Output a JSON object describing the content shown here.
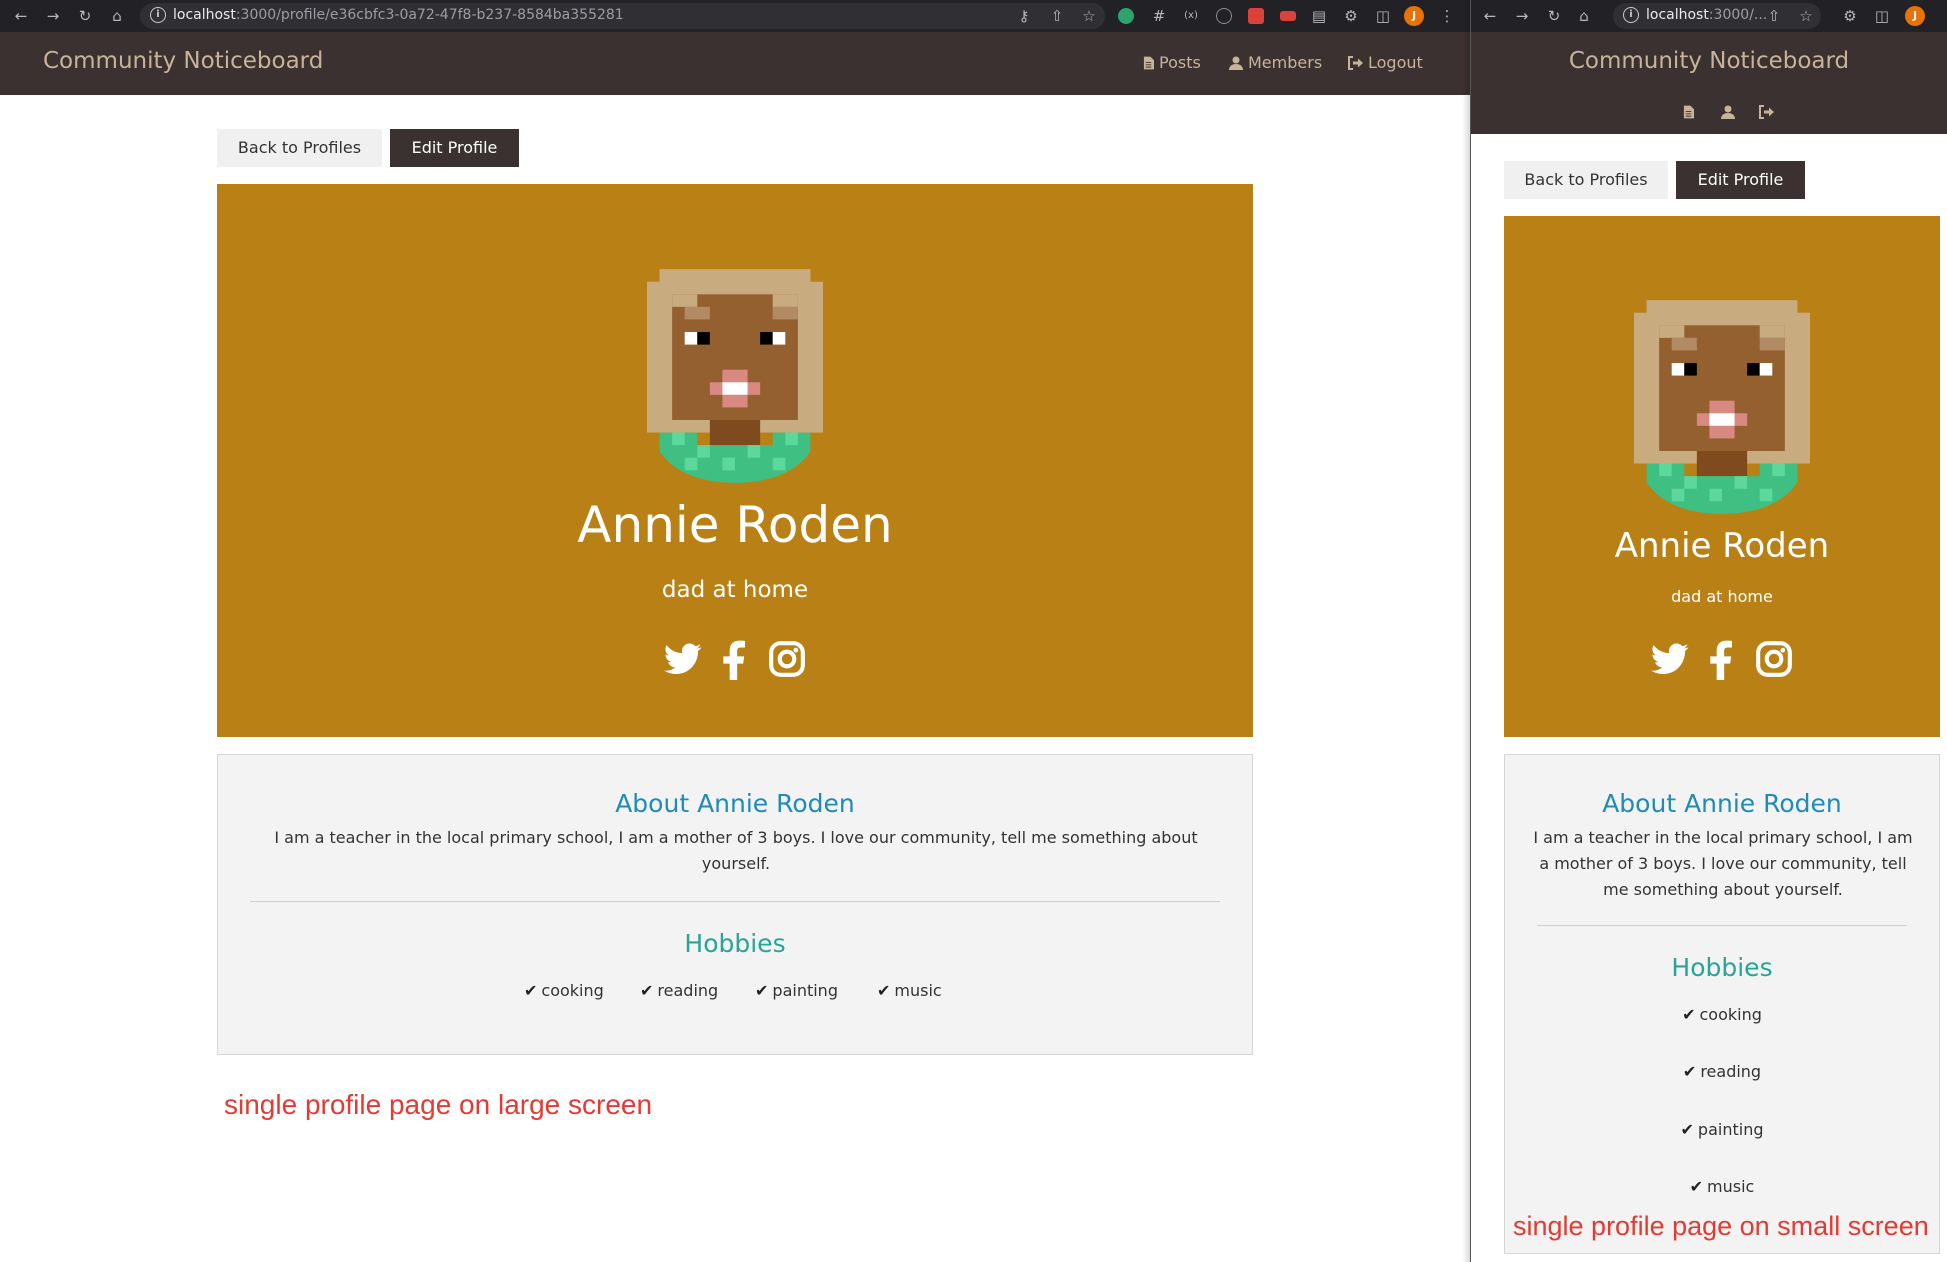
{
  "large": {
    "url_host": "localhost",
    "url_path": ":3000/profile/e36cbfc3-0a72-47f8-b237-8584ba355281",
    "brand": "Community Noticeboard",
    "nav": {
      "posts": "Posts",
      "members": "Members",
      "logout": "Logout"
    },
    "back_label": "Back to Profiles",
    "edit_label": "Edit Profile",
    "profile": {
      "name": "Annie Roden",
      "tagline": "dad at home"
    },
    "about_title": "About Annie Roden",
    "about_text": "I am a teacher in the local primary school, I am a mother of 3 boys. I love our community, tell me something about yourself.",
    "hobbies_title": "Hobbies",
    "hobbies": [
      "cooking",
      "reading",
      "painting",
      "music"
    ],
    "caption": "single profile page on large screen"
  },
  "small": {
    "url_host": "localhost",
    "url_path": ":3000/...",
    "brand": "Community Noticeboard",
    "back_label": "Back to Profiles",
    "edit_label": "Edit Profile",
    "profile": {
      "name": "Annie Roden",
      "tagline": "dad at home"
    },
    "about_title": "About Annie Roden",
    "about_text": "I am a teacher in the local primary school, I am a mother of 3 boys. I love our community, tell me something about yourself.",
    "hobbies_title": "Hobbies",
    "hobbies": [
      "cooking",
      "reading",
      "painting",
      "music"
    ],
    "caption": "single profile page on small screen"
  },
  "colors": {
    "navbar": "#3a3130",
    "brand_text": "#c8b39a",
    "hero_bg": "#b88015",
    "about_title": "#1f8bb8",
    "hobbies_title": "#27a597",
    "caption": "#e43a32"
  },
  "icons": [
    "back-icon",
    "forward-icon",
    "reload-icon",
    "home-icon",
    "info-icon",
    "key-icon",
    "share-icon",
    "star-icon",
    "puzzle-icon",
    "sidebar-icon",
    "menu-icon",
    "file-icon",
    "user-icon",
    "logout-icon",
    "twitter-icon",
    "facebook-icon",
    "instagram-icon",
    "check-icon"
  ]
}
